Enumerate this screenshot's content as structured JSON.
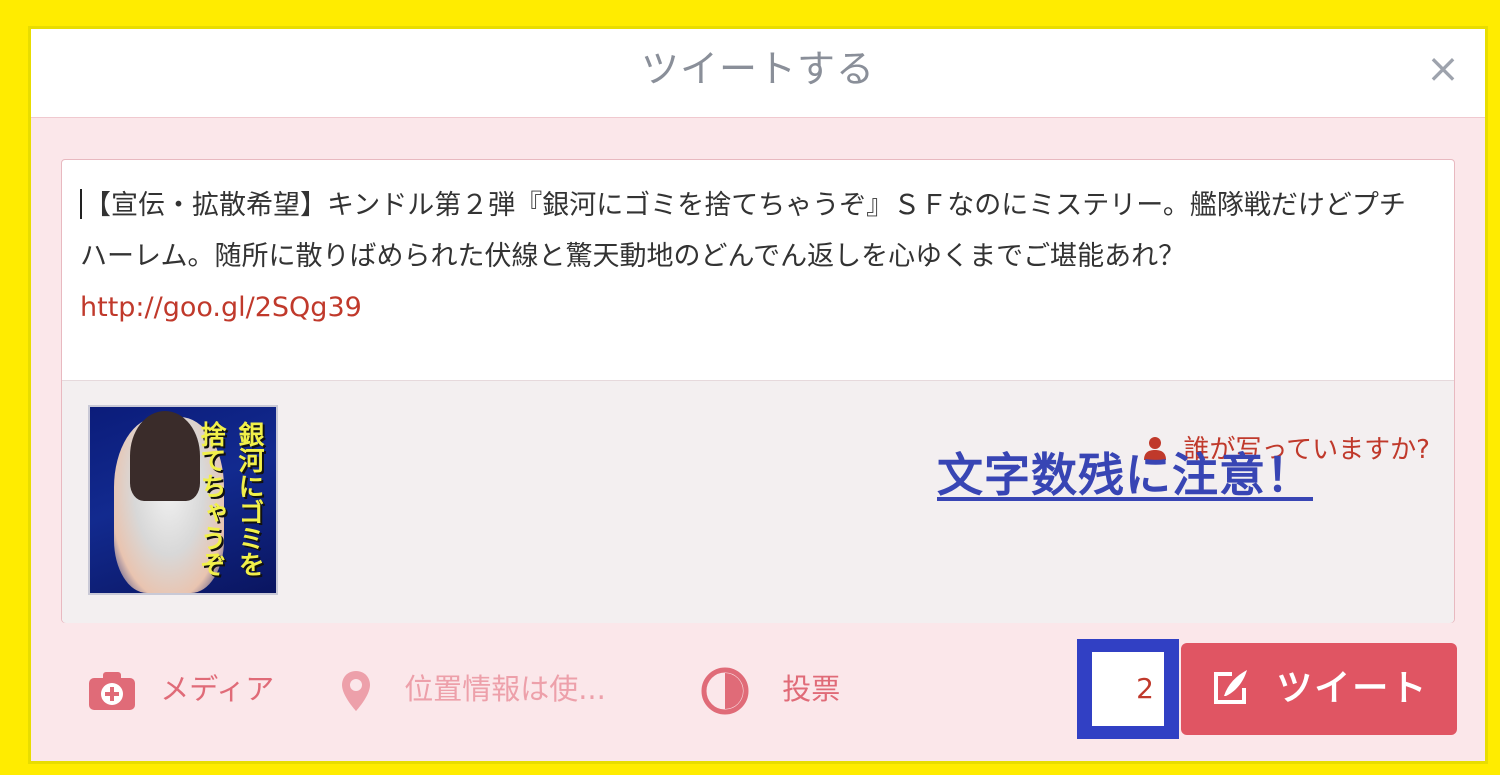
{
  "dialog": {
    "title": "ツイートする",
    "close_label": "×"
  },
  "compose": {
    "text_main": "【宣伝・拡散希望】キンドル第２弾『銀河にゴミを捨てちゃうぞ』ＳＦなのにミステリー。艦隊戦だけどプチハーレム。随所に散りばめられた伏線と驚天動地のどんでん返しを心ゆくまでご堪能あれ？",
    "link": "http://goo.gl/2SQg39",
    "thumbnail_title": "銀河にゴミを捨てちゃうぞ",
    "tag_people_label": "誰が写っていますか?",
    "tag_icon": "user-icon"
  },
  "overlay": {
    "warning": "文字数残に注意！"
  },
  "toolbar": {
    "media_label": "メディア",
    "media_icon": "camera-plus-icon",
    "location_label": "位置情報は使...",
    "location_icon": "map-pin-icon",
    "poll_label": "投票",
    "poll_icon": "poll-chart-icon"
  },
  "counter": {
    "remaining": "2"
  },
  "submit": {
    "label": "ツイート",
    "icon": "compose-quill-icon"
  },
  "colors": {
    "frame": "#ffec00",
    "accent": "#e05563",
    "link": "#c0392b",
    "warning": "#3845b4",
    "counter_border": "#3140c4",
    "dialog_bg": "#fbe7ea"
  }
}
